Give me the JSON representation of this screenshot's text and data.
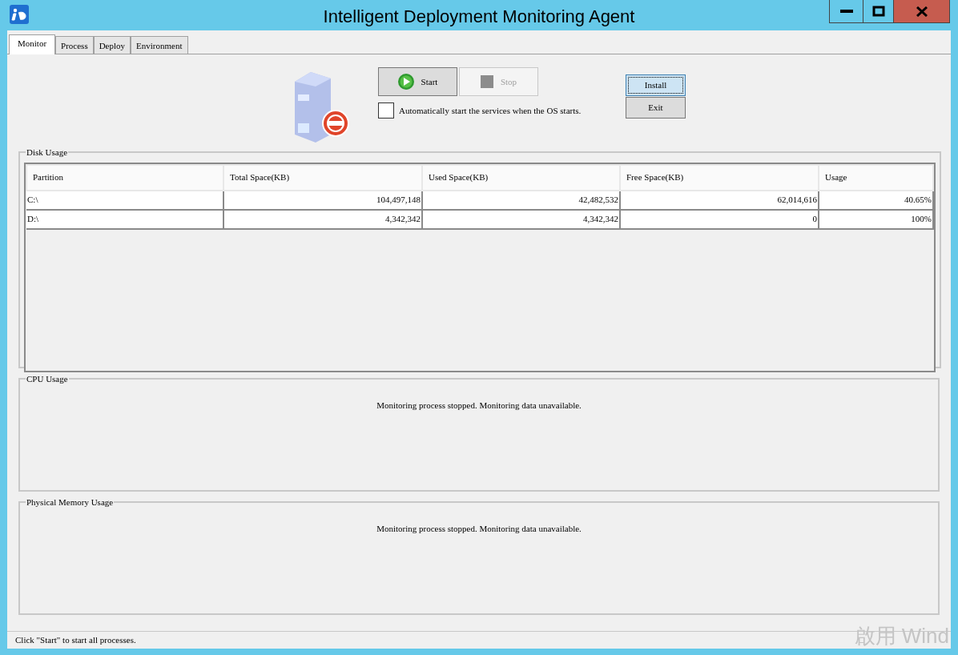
{
  "window": {
    "title": "Intelligent Deployment Monitoring Agent"
  },
  "tabs": [
    {
      "label": "Monitor",
      "selected": true
    },
    {
      "label": "Process",
      "selected": false
    },
    {
      "label": "Deploy",
      "selected": false
    },
    {
      "label": "Environment",
      "selected": false
    }
  ],
  "controls": {
    "buttons": [
      {
        "label": "Start",
        "kind": "start",
        "disabled": false
      },
      {
        "label": "Stop",
        "kind": "stop",
        "disabled": true
      }
    ],
    "autostart": {
      "label": "Automatically start the services when the OS starts.",
      "checked": false
    },
    "side_buttons": [
      {
        "label": "Install",
        "focused": true
      },
      {
        "label": "Exit",
        "focused": false
      }
    ]
  },
  "disk_usage": {
    "title": "Disk Usage",
    "columns": [
      "Partition",
      "Total Space(KB)",
      "Used Space(KB)",
      "Free Space(KB)",
      "Usage"
    ],
    "rows": [
      [
        "C:\\",
        "104,497,148",
        "42,482,532",
        "62,014,616",
        "40.65%"
      ],
      [
        "D:\\",
        "4,342,342",
        "4,342,342",
        "0",
        "100%"
      ]
    ]
  },
  "cpu_usage": {
    "title": "CPU Usage",
    "message": "Monitoring process stopped. Monitoring data unavailable."
  },
  "memory_usage": {
    "title": "Physical Memory Usage",
    "message": "Monitoring process stopped. Monitoring data unavailable."
  },
  "status_bar": "Click \"Start\" to start all processes.",
  "activation_notice": "啟用 Wind"
}
